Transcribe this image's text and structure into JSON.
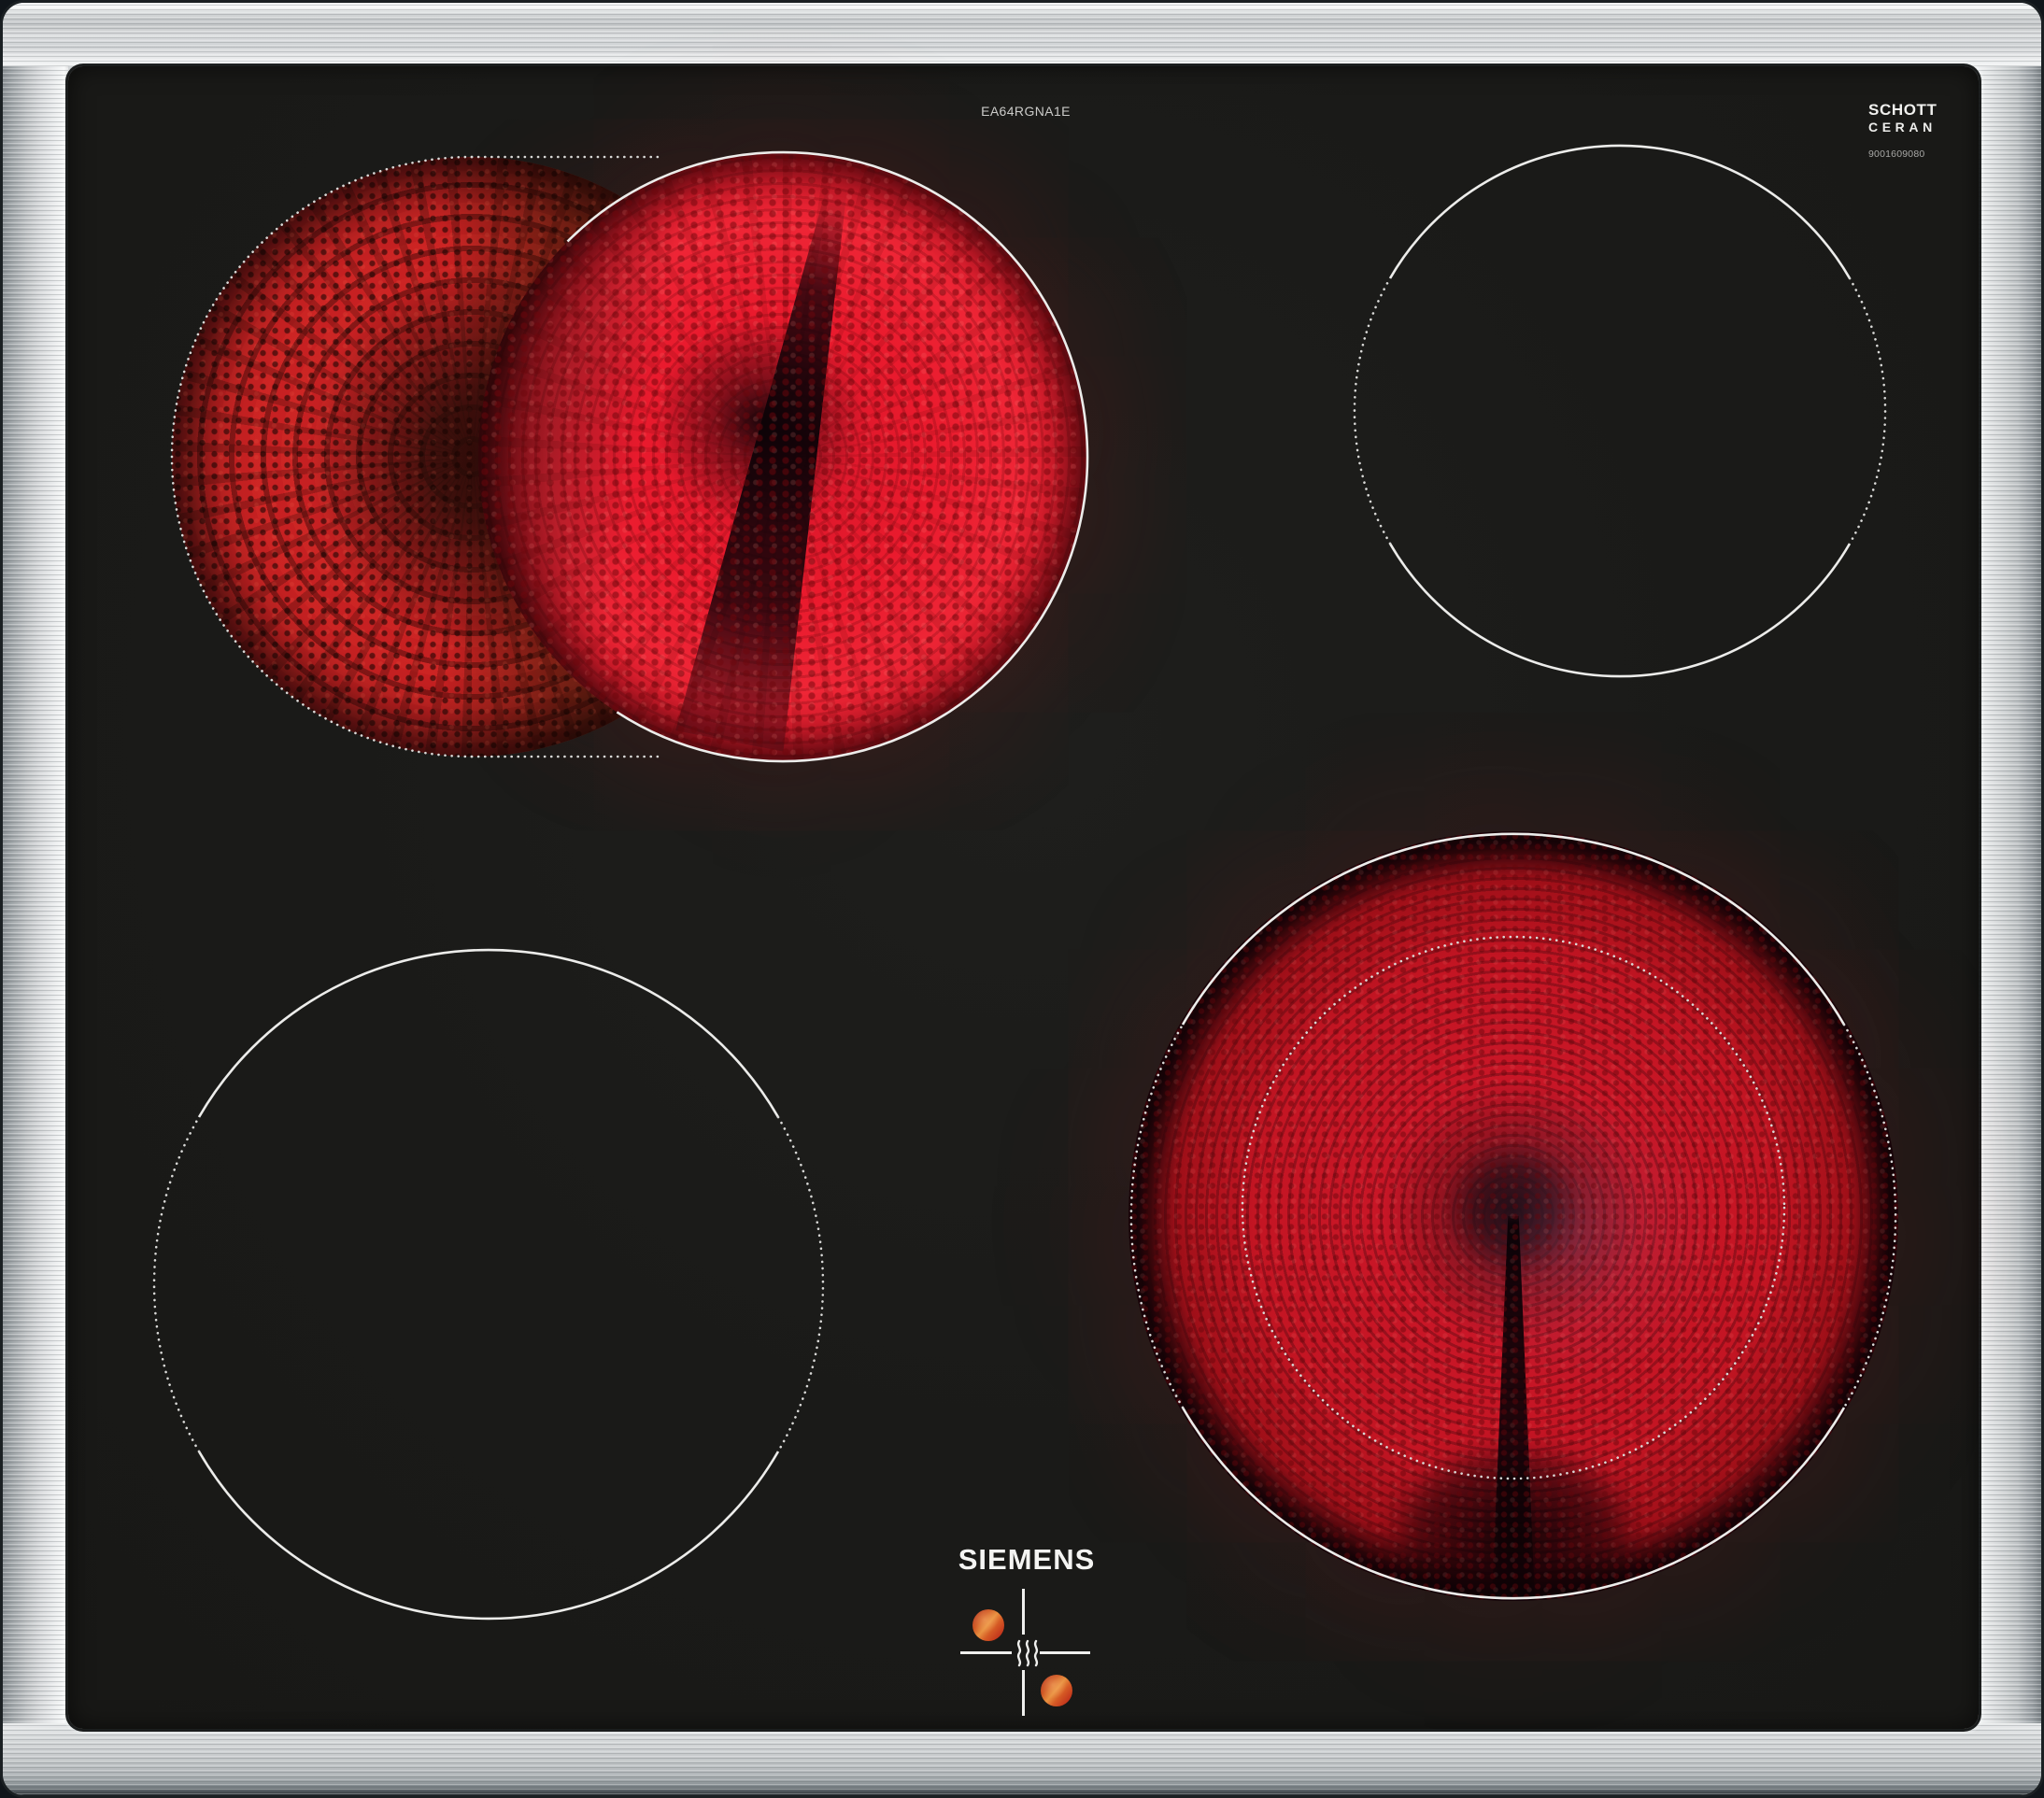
{
  "appliance": {
    "brand": "SIEMENS",
    "model_number": "EA64RGNA1E",
    "glass_brand_line1": "SCHOTT",
    "glass_brand_line2": "CERAN",
    "glass_code": "9001609080"
  },
  "zones": {
    "back_left": {
      "position": "back-left",
      "state": "on",
      "shape": "dual-stadium"
    },
    "back_right": {
      "position": "back-right",
      "state": "off",
      "shape": "single-circle"
    },
    "front_left": {
      "position": "front-left",
      "state": "off",
      "shape": "single-circle"
    },
    "front_right": {
      "position": "front-right",
      "state": "on",
      "shape": "dual-circuit"
    }
  },
  "icons": [
    "heat-waves-icon",
    "residual-heat-dot",
    "zone-cross-marking"
  ],
  "colors": {
    "frame_steel": "#d3d6d7",
    "frame_edge_dark": "#272d31",
    "glass_black": "#1a1a18",
    "element_red_bright": "#ee2636",
    "element_red_deep": "#a20e1a",
    "ember_brown": "#3d2212",
    "marking_white": "#ececea",
    "indicator_dot_orange": "#e89140",
    "indicator_dot_red": "#bd2c1a"
  }
}
